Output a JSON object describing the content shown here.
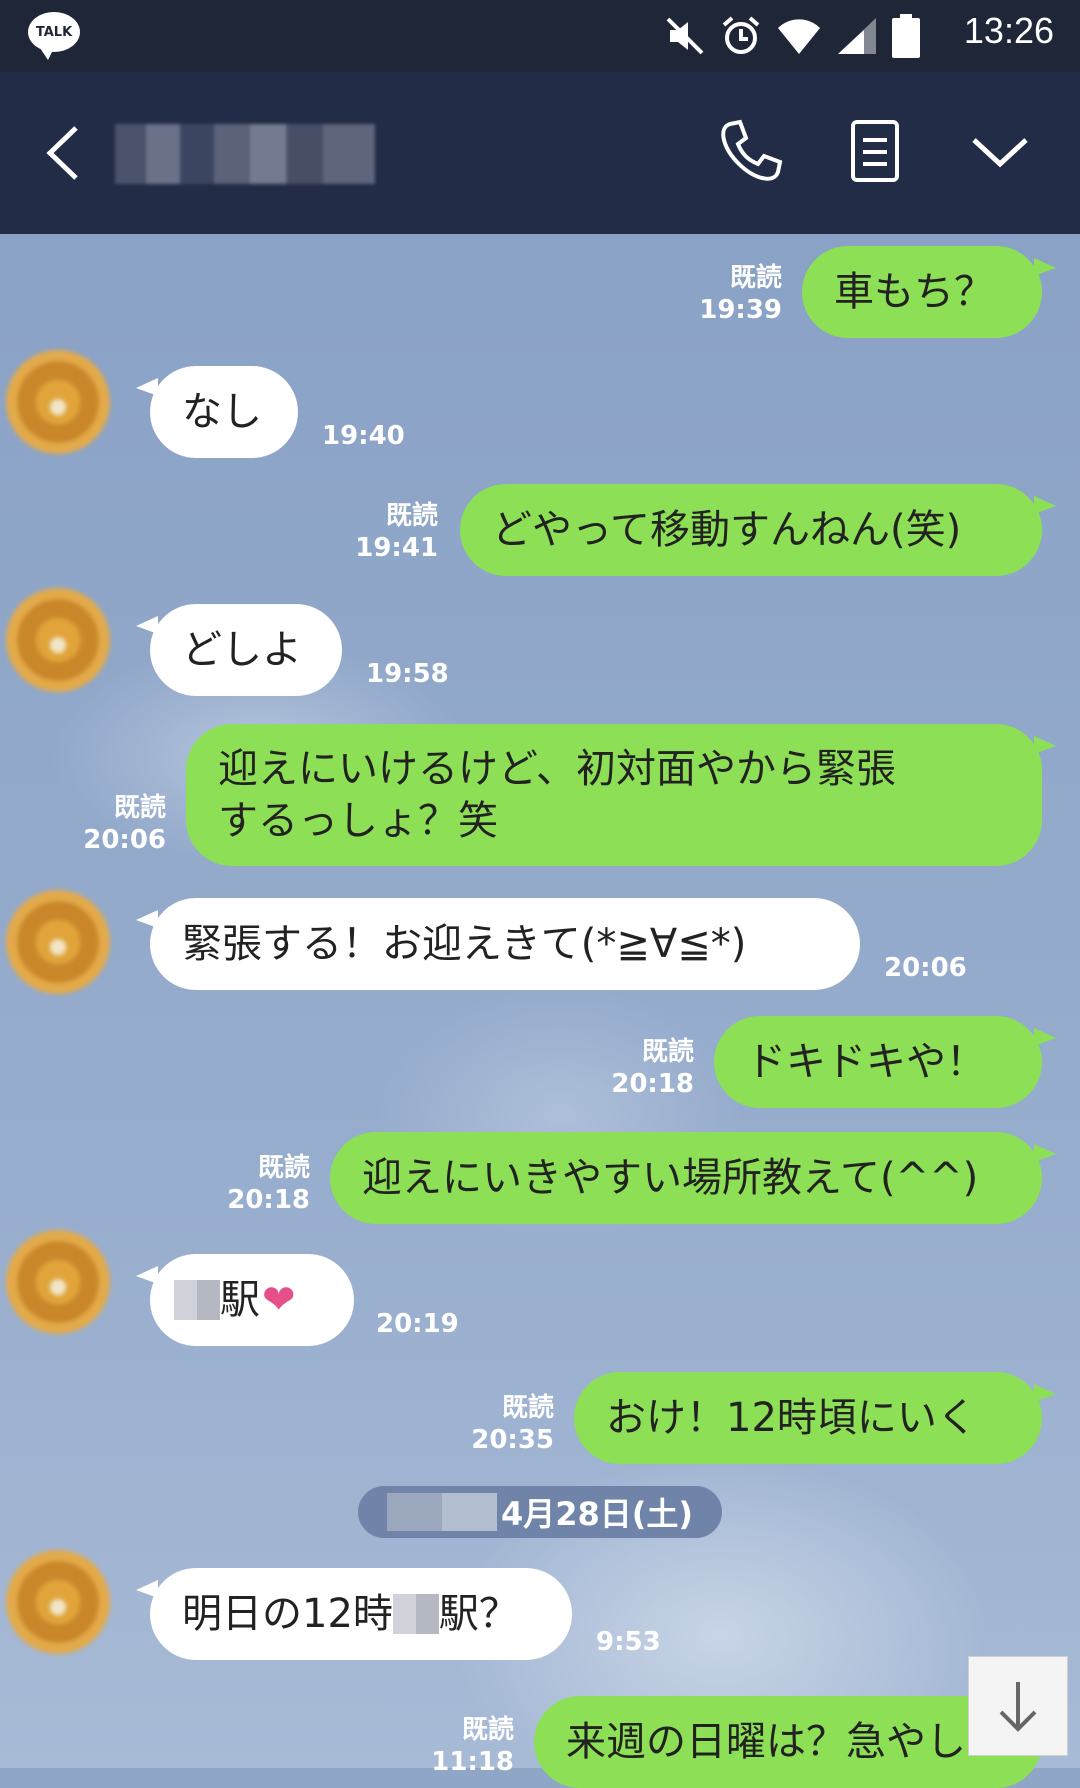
{
  "status_bar": {
    "app_icon_label": "TALK",
    "time": "13:26",
    "icons": [
      "mute-icon",
      "alarm-icon",
      "wifi-icon",
      "signal-icon",
      "battery-icon"
    ]
  },
  "header": {
    "back_icon": "chevron-left-icon",
    "call_icon": "phone-icon",
    "notes_icon": "notes-icon",
    "menu_icon": "chevron-down-icon"
  },
  "messages": [
    {
      "side": "me",
      "text": "車もち？",
      "read": "既読",
      "time": "19:39"
    },
    {
      "side": "them",
      "text": "なし",
      "time": "19:40"
    },
    {
      "side": "me",
      "text": "どやって移動すんねん(笑)",
      "read": "既読",
      "time": "19:41"
    },
    {
      "side": "them",
      "text": "どしよ",
      "time": "19:58"
    },
    {
      "side": "me",
      "text_line1": "迎えにいけるけど、初対面やから緊張",
      "text_line2": "するっしょ？笑",
      "read": "既読",
      "time": "20:06"
    },
    {
      "side": "them",
      "text": "緊張する！お迎えきて(*≧∀≦*)",
      "time": "20:06"
    },
    {
      "side": "me",
      "text": "ドキドキや！",
      "read": "既読",
      "time": "20:18"
    },
    {
      "side": "me",
      "text": "迎えにいきやすい場所教えて(^^)",
      "read": "既読",
      "time": "20:18"
    },
    {
      "side": "them",
      "text": "駅",
      "emoji": "❤",
      "time": "20:19"
    },
    {
      "side": "me",
      "text": "おけ！12時頃にいく",
      "read": "既読",
      "time": "20:35"
    },
    {
      "side": "them",
      "text_a": "明日の12時",
      "text_b": "駅？",
      "time": "9:53"
    },
    {
      "side": "me",
      "text": "来週の日曜は？急やし",
      "read": "既読",
      "time": "11:18"
    }
  ],
  "date_separator": "4月28日(土)",
  "scroll_down_icon": "arrow-down-icon"
}
